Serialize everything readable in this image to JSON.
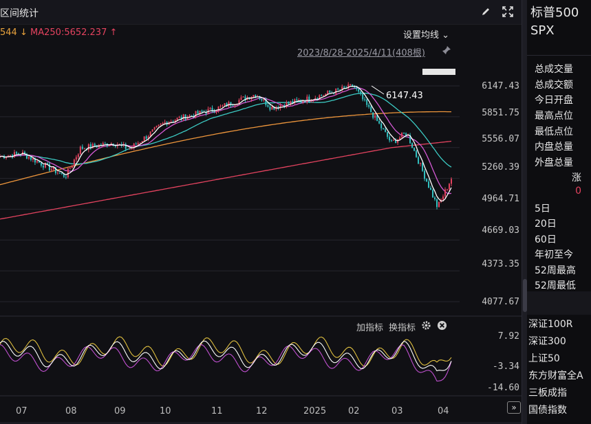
{
  "header": {
    "title": "区间统计"
  },
  "legend": {
    "ma_a_text": "544",
    "ma_a_arrow": "↓",
    "ma_b_text": "MA250:5652.237",
    "ma_b_arrow": "↑",
    "settings_label": "设置均线",
    "range_label": "2023/8/28-2025/4/11(408根)"
  },
  "main_axis": {
    "labels": [
      "6147.43",
      "5851.75",
      "5556.07",
      "5260.39",
      "4964.71",
      "4669.03",
      "4373.35",
      "4077.67"
    ],
    "range": [
      4077.67,
      6147.43
    ],
    "high_marker": "6147.43"
  },
  "indicator": {
    "add_label": "加指标",
    "switch_label": "换指标",
    "axis_labels": [
      "7.92",
      "-3.34",
      "-14.60"
    ]
  },
  "x_axis": {
    "labels": [
      "07",
      "08",
      "09",
      "10",
      "11",
      "12",
      "2025",
      "02",
      "03",
      "04"
    ]
  },
  "colors": {
    "up": "#e4435f",
    "down": "#33c3c3",
    "ma5": "#ffffff",
    "ma20": "#d65ad6",
    "ma60": "#3ccbc4",
    "ma120": "#f0973c",
    "ma250": "#e4435f",
    "kdj_k": "#ffffff",
    "kdj_d": "#e0c040",
    "kdj_j": "#c050d0"
  },
  "chart_data": {
    "type": "candlestick",
    "ylim": [
      4077.67,
      6147.43
    ],
    "close_series": [
      {
        "month": "07",
        "value": 5500
      },
      {
        "month": "08",
        "value": 5280
      },
      {
        "month": "08",
        "value": 5550
      },
      {
        "month": "09",
        "value": 5600
      },
      {
        "month": "09",
        "value": 5540
      },
      {
        "month": "10",
        "value": 5800
      },
      {
        "month": "11",
        "value": 5930
      },
      {
        "month": "12",
        "value": 6070
      },
      {
        "month": "12",
        "value": 5940
      },
      {
        "month": "2025",
        "value": 6040
      },
      {
        "month": "02",
        "value": 6147.43
      },
      {
        "month": "03",
        "value": 5600
      },
      {
        "month": "03",
        "value": 5700
      },
      {
        "month": "04",
        "value": 4982
      },
      {
        "month": "04",
        "value": 5260
      }
    ]
  },
  "right_panel": {
    "name_line1": "标普500",
    "name_line2": "SPX",
    "stats": [
      "总成交量",
      "总成交额",
      "今日开盘",
      "最高点位",
      "最低点位",
      "内盘总量",
      "外盘总量"
    ],
    "change_label": "涨",
    "change_value": "0",
    "periods": [
      "5日",
      "20日",
      "60日",
      "年初至今",
      "52周最高",
      "52周最低"
    ],
    "indices": [
      "深证100R",
      "深证300",
      "上证50",
      "东方财富全A",
      "三板成指",
      "国债指数"
    ]
  }
}
